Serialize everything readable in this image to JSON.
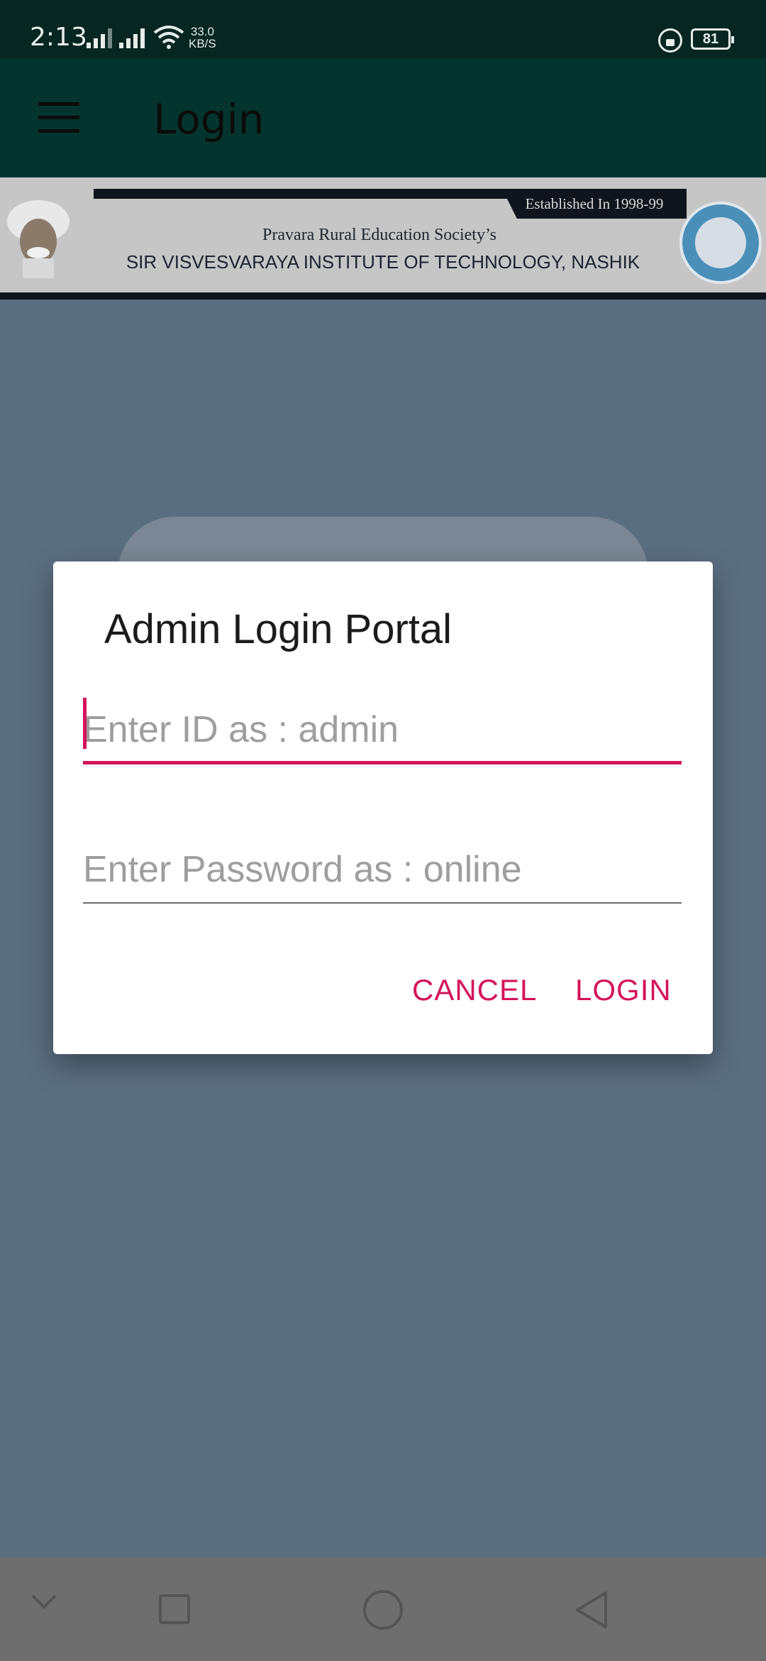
{
  "status_bar": {
    "time": "2:13",
    "net_speed_value": "33.0",
    "net_speed_unit": "KB/S",
    "battery": "81"
  },
  "app_bar": {
    "title": "Login",
    "menu_icon": "hamburger-menu-icon"
  },
  "banner": {
    "established": "Established In 1998-99",
    "society": "Pravara Rural Education Society’s",
    "institute": "SIR VISVESVARAYA INSTITUTE OF TECHNOLOGY, NASHIK"
  },
  "dialog": {
    "title": "Admin Login Portal",
    "id_field": {
      "value": "",
      "placeholder": "Enter ID as : admin"
    },
    "password_field": {
      "value": "",
      "placeholder": "Enter Password as : online"
    },
    "cancel_label": "CANCEL",
    "login_label": "LOGIN"
  },
  "colors": {
    "accent": "#d4145a",
    "app_bar": "#03352e",
    "status_bar": "#062621"
  },
  "nav_bar": {
    "icons": [
      "chevron-down-icon",
      "recent-apps-icon",
      "home-icon",
      "back-icon"
    ]
  }
}
